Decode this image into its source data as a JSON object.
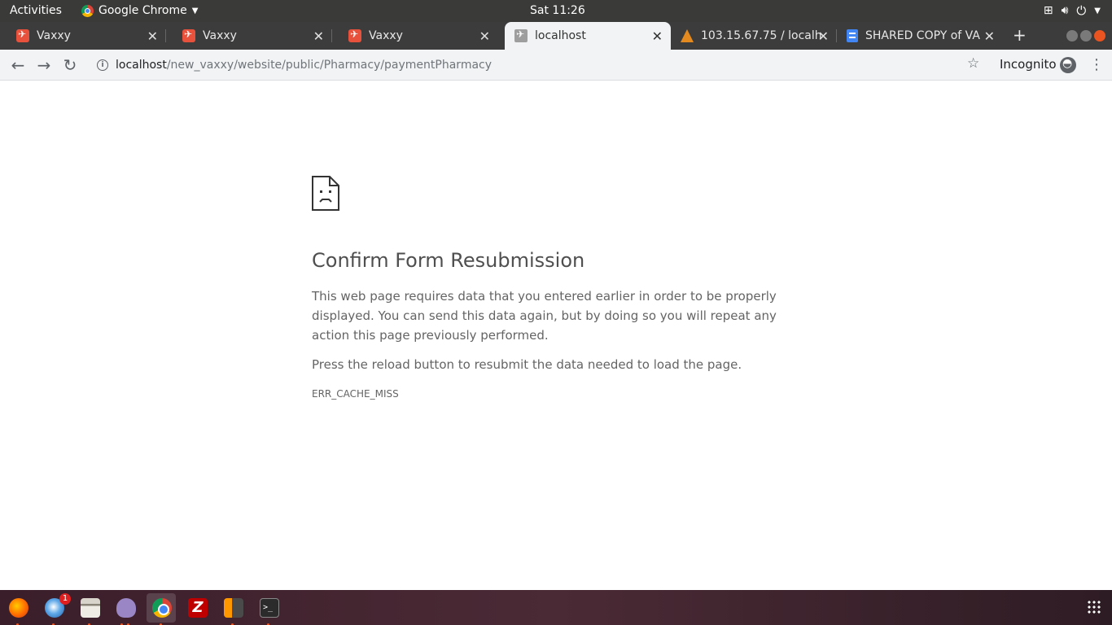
{
  "topbar": {
    "activities": "Activities",
    "app_name": "Google Chrome",
    "clock": "Sat 11:26"
  },
  "tabs": [
    {
      "title": "Vaxxy",
      "favicon": "vaxxy-icon",
      "active": false
    },
    {
      "title": "Vaxxy",
      "favicon": "vaxxy-icon",
      "active": false
    },
    {
      "title": "Vaxxy",
      "favicon": "vaxxy-icon",
      "active": false
    },
    {
      "title": "localhost",
      "favicon": "page-icon",
      "active": true
    },
    {
      "title": "103.15.67.75 / localh",
      "favicon": "phpmyadmin-icon",
      "active": false
    },
    {
      "title": "SHARED COPY of VA",
      "favicon": "google-docs-icon",
      "active": false
    }
  ],
  "toolbar": {
    "url_host": "localhost",
    "url_path": "/new_vaxxy/website/public/Pharmacy/paymentPharmacy",
    "incognito_label": "Incognito"
  },
  "error_page": {
    "heading": "Confirm Form Resubmission",
    "paragraph": "This web page requires data that you entered earlier in order to be properly displayed. You can send this data again, but by doing so you will repeat any action this page previously performed.",
    "instruction": "Press the reload button to resubmit the data needed to load the page.",
    "error_code": "ERR_CACHE_MISS"
  },
  "dock": {
    "apps": [
      "firefox-icon",
      "thunderbird-icon",
      "files-icon",
      "pidgin-icon",
      "chrome-icon",
      "filezilla-icon",
      "sublime-text-icon",
      "terminal-icon"
    ],
    "thunderbird_badge": "1"
  },
  "colors": {
    "accent": "#e95420",
    "tab_strip": "#3c3c3c",
    "toolbar": "#f1f3f4"
  }
}
